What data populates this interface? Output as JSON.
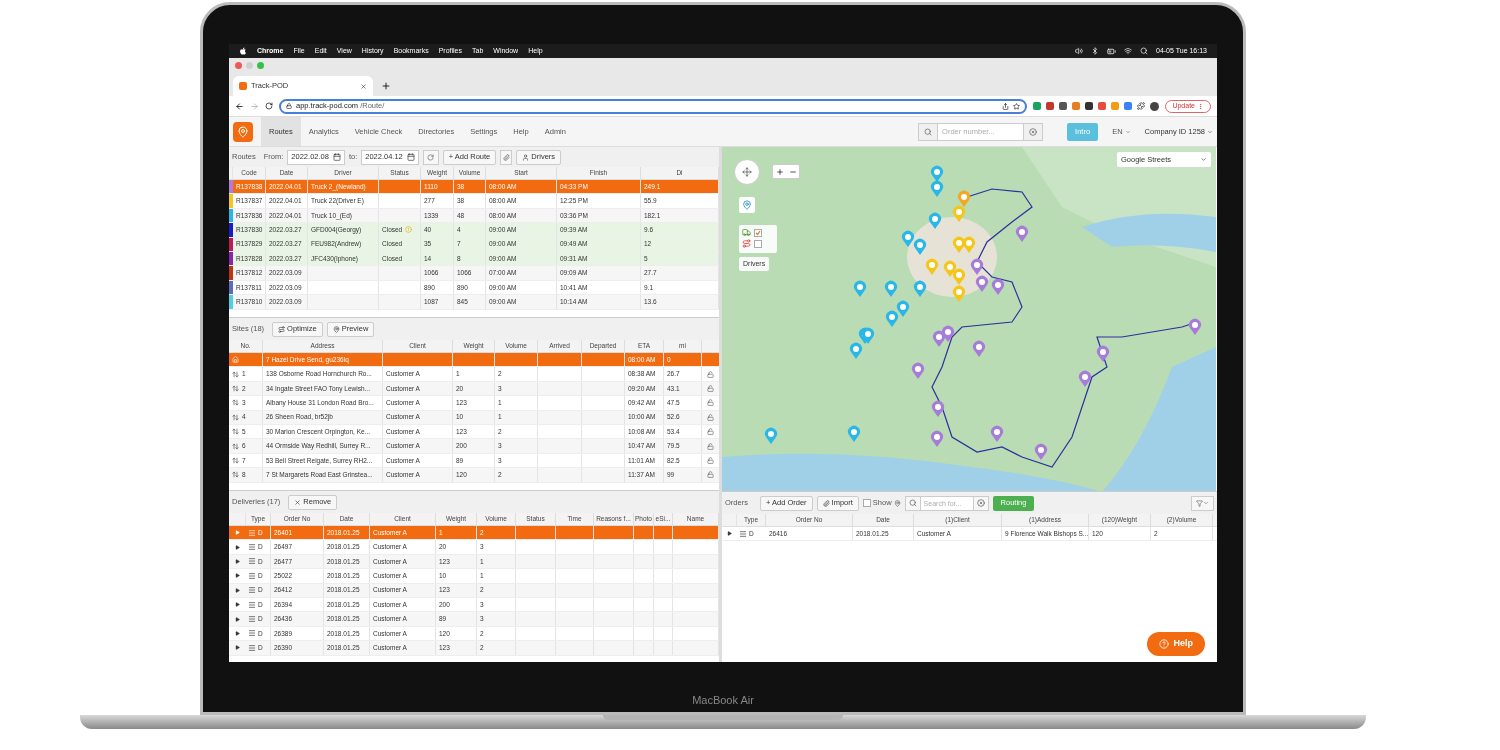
{
  "menu_bar": {
    "app": "Chrome",
    "items": [
      "File",
      "Edit",
      "View",
      "History",
      "Bookmarks",
      "Profiles",
      "Tab",
      "Window",
      "Help"
    ],
    "clock": "04-05 Tue 16:13"
  },
  "browser": {
    "tab_title": "Track-POD",
    "url_host": "app.track-pod.com",
    "url_path": "/Route/",
    "update_label": "Update"
  },
  "nav": {
    "items": [
      {
        "label": "Routes",
        "selected": true
      },
      {
        "label": "Analytics",
        "selected": false
      },
      {
        "label": "Vehicle Check",
        "selected": false
      },
      {
        "label": "Directories",
        "selected": false
      },
      {
        "label": "Settings",
        "selected": false
      },
      {
        "label": "Help",
        "selected": false
      },
      {
        "label": "Admin",
        "selected": false
      }
    ],
    "search": {
      "placeholder": "Order number..."
    },
    "intro": "Intro",
    "language": "EN",
    "company": "Company ID 1258"
  },
  "routes": {
    "title": "Routes",
    "from_label": "From:",
    "from": "2022.02.08",
    "to_label": "to:",
    "to": "2022.04.12",
    "add_label": "+ Add Route",
    "drivers_label": "Drivers",
    "columns": [
      "Code",
      "Date",
      "Driver",
      "Status",
      "Weight",
      "Volume",
      "Start",
      "Finish",
      "Di"
    ],
    "rows": [
      {
        "code": "R137838",
        "date": "2022.04.01",
        "driver": "Truck 2_(Newland)",
        "weight": "1110",
        "volume": "38",
        "start": "08:00 AM",
        "finish": "04:33 PM",
        "distance": "249.1",
        "color": "#b07ce0",
        "selected": true,
        "closed": false,
        "warning": false
      },
      {
        "code": "R137837",
        "date": "2022.04.01",
        "driver": "Truck 22(Driver E)",
        "weight": "277",
        "volume": "38",
        "start": "08:00 AM",
        "finish": "12:25 PM",
        "distance": "55.9",
        "color": "#f5c518",
        "selected": false,
        "closed": false,
        "warning": false
      },
      {
        "code": "R137836",
        "date": "2022.04.01",
        "driver": "Truck 10_(Ed)",
        "weight": "1339",
        "volume": "48",
        "start": "08:00 AM",
        "finish": "03:36 PM",
        "distance": "182.1",
        "color": "#29b6e8",
        "selected": false,
        "closed": false,
        "warning": false
      },
      {
        "code": "R137830",
        "date": "2022.03.27",
        "driver": "GFD004(Georgy)",
        "status": "Closed",
        "weight": "40",
        "volume": "4",
        "start": "09:00 AM",
        "finish": "09:39 AM",
        "distance": "9.6",
        "color": "#1a1acd",
        "selected": false,
        "closed": true,
        "warning": true
      },
      {
        "code": "R137829",
        "date": "2022.03.27",
        "driver": "FEU982(Andrew)",
        "status": "Closed",
        "weight": "35",
        "volume": "7",
        "start": "09:00 AM",
        "finish": "09:49 AM",
        "distance": "12",
        "color": "#c2185b",
        "selected": false,
        "closed": true,
        "warning": false
      },
      {
        "code": "R137828",
        "date": "2022.03.27",
        "driver": "JFC430(Iphone)",
        "status": "Closed",
        "weight": "14",
        "volume": "8",
        "start": "09:00 AM",
        "finish": "09:31 AM",
        "distance": "5",
        "color": "#8e24aa",
        "selected": false,
        "closed": true,
        "warning": false
      },
      {
        "code": "R137812",
        "date": "2022.03.09",
        "weight": "1066",
        "volume": "1066",
        "start": "07:00 AM",
        "finish": "09:09 AM",
        "distance": "27.7",
        "color": "#bf360c",
        "selected": false,
        "closed": false,
        "warning": false
      },
      {
        "code": "R137811",
        "date": "2022.03.09",
        "weight": "890",
        "volume": "890",
        "start": "09:00 AM",
        "finish": "10:41 AM",
        "distance": "9.1",
        "color": "#5c6bc0",
        "selected": false,
        "closed": false,
        "warning": false
      },
      {
        "code": "R137810",
        "date": "2022.03.09",
        "weight": "1087",
        "volume": "845",
        "start": "09:00 AM",
        "finish": "10:14 AM",
        "distance": "13.6",
        "color": "#4dd0e1",
        "selected": false,
        "closed": false,
        "warning": false
      }
    ]
  },
  "sites": {
    "title": "Sites (18)",
    "optimize_label": "Optimize",
    "preview_label": "Preview",
    "columns": [
      "No.",
      "Address",
      "Client",
      "Weight",
      "Volume",
      "Arrived",
      "Departed",
      "ETA",
      "mi"
    ],
    "rows": [
      {
        "kind": "depot",
        "address": "7 Hazel Drive Send, gu236lq",
        "eta": "08:00 AM",
        "mi": "0",
        "selected": true
      },
      {
        "kind": "stop",
        "no": "1",
        "address": "138 Osborne Road Hornchurch Ro...",
        "client": "Customer A",
        "weight": "1",
        "volume": "2",
        "eta": "08:38 AM",
        "mi": "26.7",
        "selected": false
      },
      {
        "kind": "stop",
        "no": "2",
        "address": "34 Ingate Street FAO Tony Lewish...",
        "client": "Customer A",
        "weight": "20",
        "volume": "3",
        "eta": "09:20 AM",
        "mi": "43.1",
        "selected": false
      },
      {
        "kind": "stop",
        "no": "3",
        "address": "Albany House 31 London Road Bro...",
        "client": "Customer A",
        "weight": "123",
        "volume": "1",
        "eta": "09:42 AM",
        "mi": "47.5",
        "selected": false
      },
      {
        "kind": "stop",
        "no": "4",
        "address": "26 Sheen Road, br52jb",
        "client": "Customer A",
        "weight": "10",
        "volume": "1",
        "eta": "10:00 AM",
        "mi": "52.6",
        "selected": false
      },
      {
        "kind": "stop",
        "no": "5",
        "address": "30 Marion Crescent Orpington, Ke...",
        "client": "Customer A",
        "weight": "123",
        "volume": "2",
        "eta": "10:08 AM",
        "mi": "53.4",
        "selected": false
      },
      {
        "kind": "stop",
        "no": "6",
        "address": "44 Ormside Way Redhill, Surrey R...",
        "client": "Customer A",
        "weight": "200",
        "volume": "3",
        "eta": "10:47 AM",
        "mi": "79.5",
        "selected": false
      },
      {
        "kind": "stop",
        "no": "7",
        "address": "53 Bell Street Reigate, Surrey RH2...",
        "client": "Customer A",
        "weight": "89",
        "volume": "3",
        "eta": "11:01 AM",
        "mi": "82.5",
        "selected": false
      },
      {
        "kind": "stop",
        "no": "8",
        "address": "7 St Margarets Road East Grinstea...",
        "client": "Customer A",
        "weight": "120",
        "volume": "2",
        "eta": "11:37 AM",
        "mi": "99",
        "selected": false
      }
    ]
  },
  "deliveries": {
    "title": "Deliveries (17)",
    "remove_label": "Remove",
    "columns": [
      "Type",
      "Order No",
      "Date",
      "Client",
      "Weight",
      "Volume",
      "Status",
      "Time",
      "Reasons f...",
      "Photo",
      "eSi...",
      "Name"
    ],
    "rows": [
      {
        "type": "D",
        "order_no": "26401",
        "date": "2018.01.25",
        "client": "Customer A",
        "weight": "1",
        "volume": "2",
        "selected": true
      },
      {
        "type": "D",
        "order_no": "26497",
        "date": "2018.01.25",
        "client": "Customer A",
        "weight": "20",
        "volume": "3",
        "selected": false
      },
      {
        "type": "D",
        "order_no": "26477",
        "date": "2018.01.25",
        "client": "Customer A",
        "weight": "123",
        "volume": "1",
        "selected": false
      },
      {
        "type": "D",
        "order_no": "25022",
        "date": "2018.01.25",
        "client": "Customer A",
        "weight": "10",
        "volume": "1",
        "selected": false
      },
      {
        "type": "D",
        "order_no": "26412",
        "date": "2018.01.25",
        "client": "Customer A",
        "weight": "123",
        "volume": "2",
        "selected": false
      },
      {
        "type": "D",
        "order_no": "26394",
        "date": "2018.01.25",
        "client": "Customer A",
        "weight": "200",
        "volume": "3",
        "selected": false
      },
      {
        "type": "D",
        "order_no": "26436",
        "date": "2018.01.25",
        "client": "Customer A",
        "weight": "89",
        "volume": "3",
        "selected": false
      },
      {
        "type": "D",
        "order_no": "26389",
        "date": "2018.01.25",
        "client": "Customer A",
        "weight": "120",
        "volume": "2",
        "selected": false
      },
      {
        "type": "D",
        "order_no": "26390",
        "date": "2018.01.25",
        "client": "Customer A",
        "weight": "123",
        "volume": "2",
        "selected": false
      }
    ]
  },
  "map": {
    "layer": "Google Streets",
    "drivers_label": "Drivers",
    "layers": [
      {
        "kind": "truck",
        "checked": true
      },
      {
        "kind": "route",
        "checked": false
      }
    ]
  },
  "orders": {
    "title": "Orders",
    "add_label": "+ Add Order",
    "import_label": "Import",
    "show_label": "Show",
    "show_checked": false,
    "search": {
      "placeholder": "Search for..."
    },
    "routing_label": "Routing",
    "columns": [
      "Type",
      "Order No",
      "Date",
      "(1)Client",
      "(1)Address",
      "(120)Weight",
      "(2)Volume"
    ],
    "rows": [
      {
        "type": "D",
        "order_no": "26416",
        "date": "2018.01.25",
        "client": "Customer A",
        "address": "9 Florence Walk Bishops S...",
        "weight": "120",
        "volume": "2"
      }
    ]
  },
  "help_label": "Help",
  "laptop": {
    "label": "MacBook Air"
  }
}
